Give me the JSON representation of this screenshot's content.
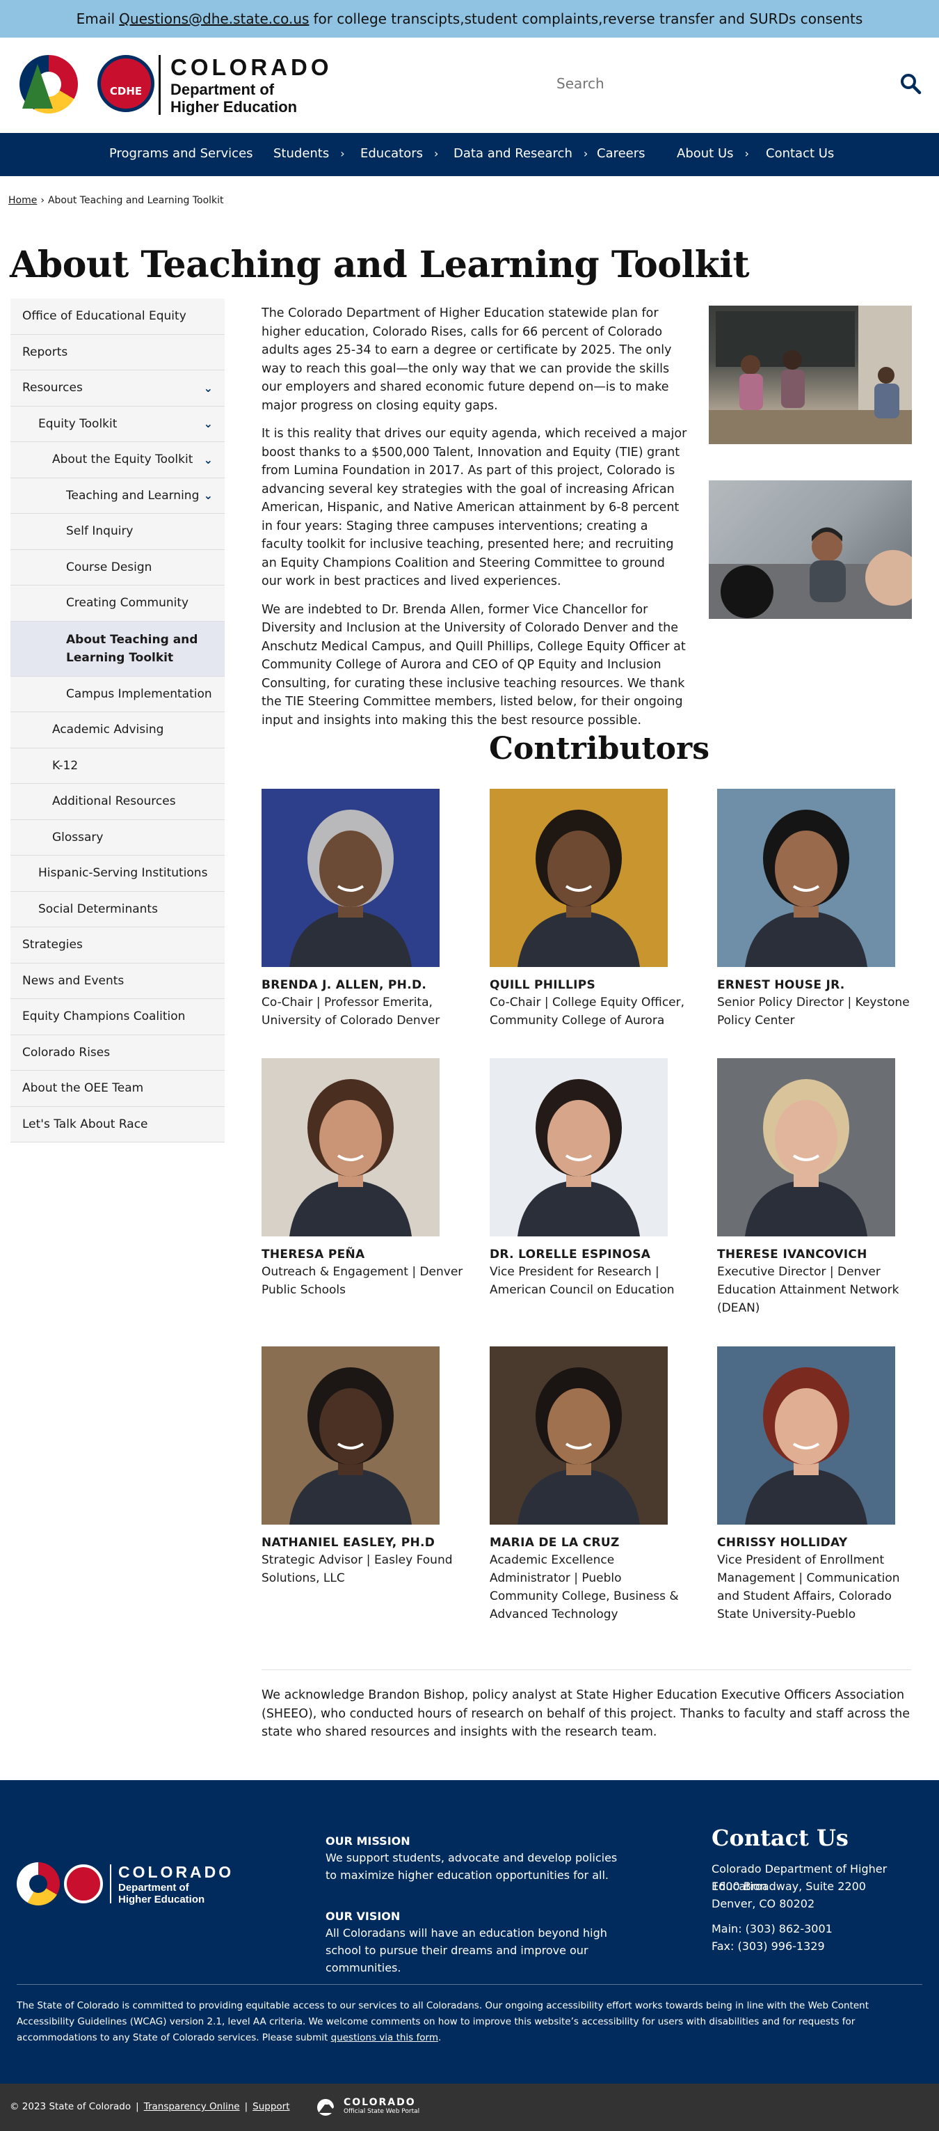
{
  "alert": {
    "prefix": "Email",
    "email": "Questions@dhe.state.co.us",
    "suffix": "for college transcipts,student complaints,reverse transfer and SURDs consents"
  },
  "logo": {
    "line1": "COLORADO",
    "line2": "Department of",
    "line3": "Higher Education",
    "badge": "CDHE"
  },
  "search": {
    "placeholder": "Search"
  },
  "nav": [
    {
      "label": "Programs and Services",
      "chevron": false
    },
    {
      "label": "Students",
      "chevron": true
    },
    {
      "label": "Educators",
      "chevron": true
    },
    {
      "label": "Data and Research",
      "chevron": true
    },
    {
      "label": "Careers",
      "chevron": false
    },
    {
      "label": "About Us",
      "chevron": true
    },
    {
      "label": "Contact Us",
      "chevron": false
    }
  ],
  "breadcrumb": {
    "home": "Home",
    "current": "About Teaching and Learning Toolkit"
  },
  "page_title": "About Teaching and Learning Toolkit",
  "sidebar": [
    {
      "label": "Office of Educational Equity",
      "level": 0,
      "chevron": false
    },
    {
      "label": "Reports",
      "level": 0,
      "chevron": false
    },
    {
      "label": "Resources",
      "level": 0,
      "chevron": true
    },
    {
      "label": "Equity Toolkit",
      "level": 1,
      "chevron": true
    },
    {
      "label": "About the Equity Toolkit",
      "level": 2,
      "chevron": true
    },
    {
      "label": "Teaching and Learning",
      "level": 3,
      "chevron": true
    },
    {
      "label": "Self Inquiry",
      "level": 3,
      "chevron": false
    },
    {
      "label": "Course Design",
      "level": 3,
      "chevron": false
    },
    {
      "label": "Creating Community",
      "level": 3,
      "chevron": false
    },
    {
      "label": "About Teaching and Learning Toolkit",
      "level": 3,
      "chevron": false,
      "active": true
    },
    {
      "label": "Campus Implementation",
      "level": 3,
      "chevron": false
    },
    {
      "label": "Academic Advising",
      "level": 2,
      "chevron": false
    },
    {
      "label": "K-12",
      "level": 2,
      "chevron": false
    },
    {
      "label": "Additional Resources",
      "level": 2,
      "chevron": false
    },
    {
      "label": "Glossary",
      "level": 2,
      "chevron": false
    },
    {
      "label": "Hispanic-Serving Institutions",
      "level": 1,
      "chevron": false
    },
    {
      "label": "Social Determinants",
      "level": 1,
      "chevron": false
    },
    {
      "label": "Strategies",
      "level": 0,
      "chevron": false
    },
    {
      "label": "News and Events",
      "level": 0,
      "chevron": false
    },
    {
      "label": "Equity Champions Coalition",
      "level": 0,
      "chevron": false
    },
    {
      "label": "Colorado Rises",
      "level": 0,
      "chevron": false
    },
    {
      "label": "About the OEE Team",
      "level": 0,
      "chevron": false
    },
    {
      "label": "Let's Talk About Race",
      "level": 0,
      "chevron": false
    }
  ],
  "intro": [
    "The Colorado Department of Higher Education statewide plan for higher education, Colorado Rises, calls for 66 percent of Colorado adults ages 25-34 to earn a degree or certificate by 2025. The only way to reach this goal—the only way that we can provide the skills our employers and shared economic future depend on—is to make major progress on closing equity gaps.",
    "It is this reality that drives our equity agenda, which received a major boost thanks to a $500,000 Talent, Innovation and Equity (TIE) grant from Lumina Foundation in 2017. As part of this project, Colorado is advancing several key strategies with the goal of increasing African American, Hispanic, and Native American attainment by 6-8 percent in four years: Staging three campuses interventions; creating a faculty toolkit for inclusive teaching, presented here; and recruiting an Equity Champions Coalition and Steering Committee to ground our work in best practices and lived experiences.",
    "We are indebted to Dr. Brenda Allen, former Vice Chancellor for Diversity and Inclusion at the University of Colorado Denver and the Anschutz Medical Campus, and Quill Phillips, College Equity Officer at Community College of Aurora and CEO of QP Equity and Inclusion Consulting, for curating these inclusive teaching resources. We thank the TIE Steering Committee members, listed below, for their ongoing input and insights into making this the best resource possible."
  ],
  "contributors_title": "Contributors",
  "contributors": [
    {
      "name": "BRENDA J. ALLEN, PH.D.",
      "role": "Co-Chair | Professor Emerita, University of Colorado Denver",
      "bg": "#2d3f8a",
      "skin": "#6b4a36",
      "hair": "#b9b9bb"
    },
    {
      "name": "QUILL PHILLIPS",
      "role": "Co-Chair | College Equity Officer, Community College of Aurora",
      "bg": "#c9952f",
      "skin": "#6f4a33",
      "hair": "#1f1712"
    },
    {
      "name": "ERNEST HOUSE JR.",
      "role": "Senior Policy Director | Keystone Policy Center",
      "bg": "#6f8ea8",
      "skin": "#9a6a4d",
      "hair": "#151515"
    },
    {
      "name": "THERESA PEÑA",
      "role": "Outreach & Engagement | Denver Public Schools",
      "bg": "#d7d1c8",
      "skin": "#c99576",
      "hair": "#4a2f20"
    },
    {
      "name": "DR. LORELLE ESPINOSA",
      "role": "Vice President for Research | American Council on Education",
      "bg": "#e9ecf1",
      "skin": "#d6a58a",
      "hair": "#241a17"
    },
    {
      "name": "THERESE IVANCOVICH",
      "role": "Executive Director | Denver Education Attainment Network (DEAN)",
      "bg": "#6b6e72",
      "skin": "#e0b59c",
      "hair": "#d9c39a"
    },
    {
      "name": "NATHANIEL EASLEY, PH.D",
      "role": "Strategic Advisor | Easley Found Solutions, LLC",
      "bg": "#8a6e52",
      "skin": "#4a3123",
      "hair": "#1c1714"
    },
    {
      "name": "MARIA DE LA CRUZ",
      "role": "Academic Excellence Administrator | Pueblo Community College, Business & Advanced Technology",
      "bg": "#4a3a2e",
      "skin": "#a0714e",
      "hair": "#1a1412"
    },
    {
      "name": "CHRISSY HOLLIDAY",
      "role": "Vice President of Enrollment Management | Communication and Student Affairs, Colorado State University-Pueblo",
      "bg": "#4d6a86",
      "skin": "#e0ae93",
      "hair": "#7a2a1e"
    }
  ],
  "acknowledgement": "We acknowledge Brandon Bishop, policy analyst at State Higher Education Executive Officers Association (SHEEO), who conducted hours of research on behalf of this project. Thanks to faculty and staff across the state who shared resources and insights with the research team.",
  "footer": {
    "mission_title": "OUR MISSION",
    "mission_text": "We support students, advocate and develop policies to maximize higher education opportunities for all.",
    "vision_title": "OUR VISION",
    "vision_text": "All Coloradans will have an education beyond high school to pursue their dreams and improve our communities.",
    "contact_title": "Contact Us",
    "org": "Colorado Department of Higher Education",
    "address1": "1600 Broadway, Suite 2200",
    "address2": "Denver, CO 80202",
    "main": "Main: (303) 862-3001",
    "fax": "Fax: (303) 996-1329",
    "accessibility": "The State of Colorado is committed to providing equitable access to our services to all Coloradans. Our ongoing accessibility effort works towards being in line with the Web Content Accessibility Guidelines (WCAG) version 2.1, level AA criteria. We welcome comments on how to improve this website’s accessibility for users with disabilities and for requests for accommodations to any State of Colorado services. Please submit",
    "accessibility_link": "questions via this form",
    "copyright": "© 2023 State of Colorado",
    "transparency": "Transparency Online",
    "support": "Support",
    "portal_line1": "COLORADO",
    "portal_line2": "Official State Web Portal"
  },
  "colors": {
    "alert_bg": "#8fc3e1",
    "nav_bg": "#002b5c",
    "footer_bg": "#002b5c",
    "bottom_bg": "#333333",
    "sidebar_bg": "#f5f5f6",
    "sidebar_active_bg": "#e4e7ef"
  }
}
